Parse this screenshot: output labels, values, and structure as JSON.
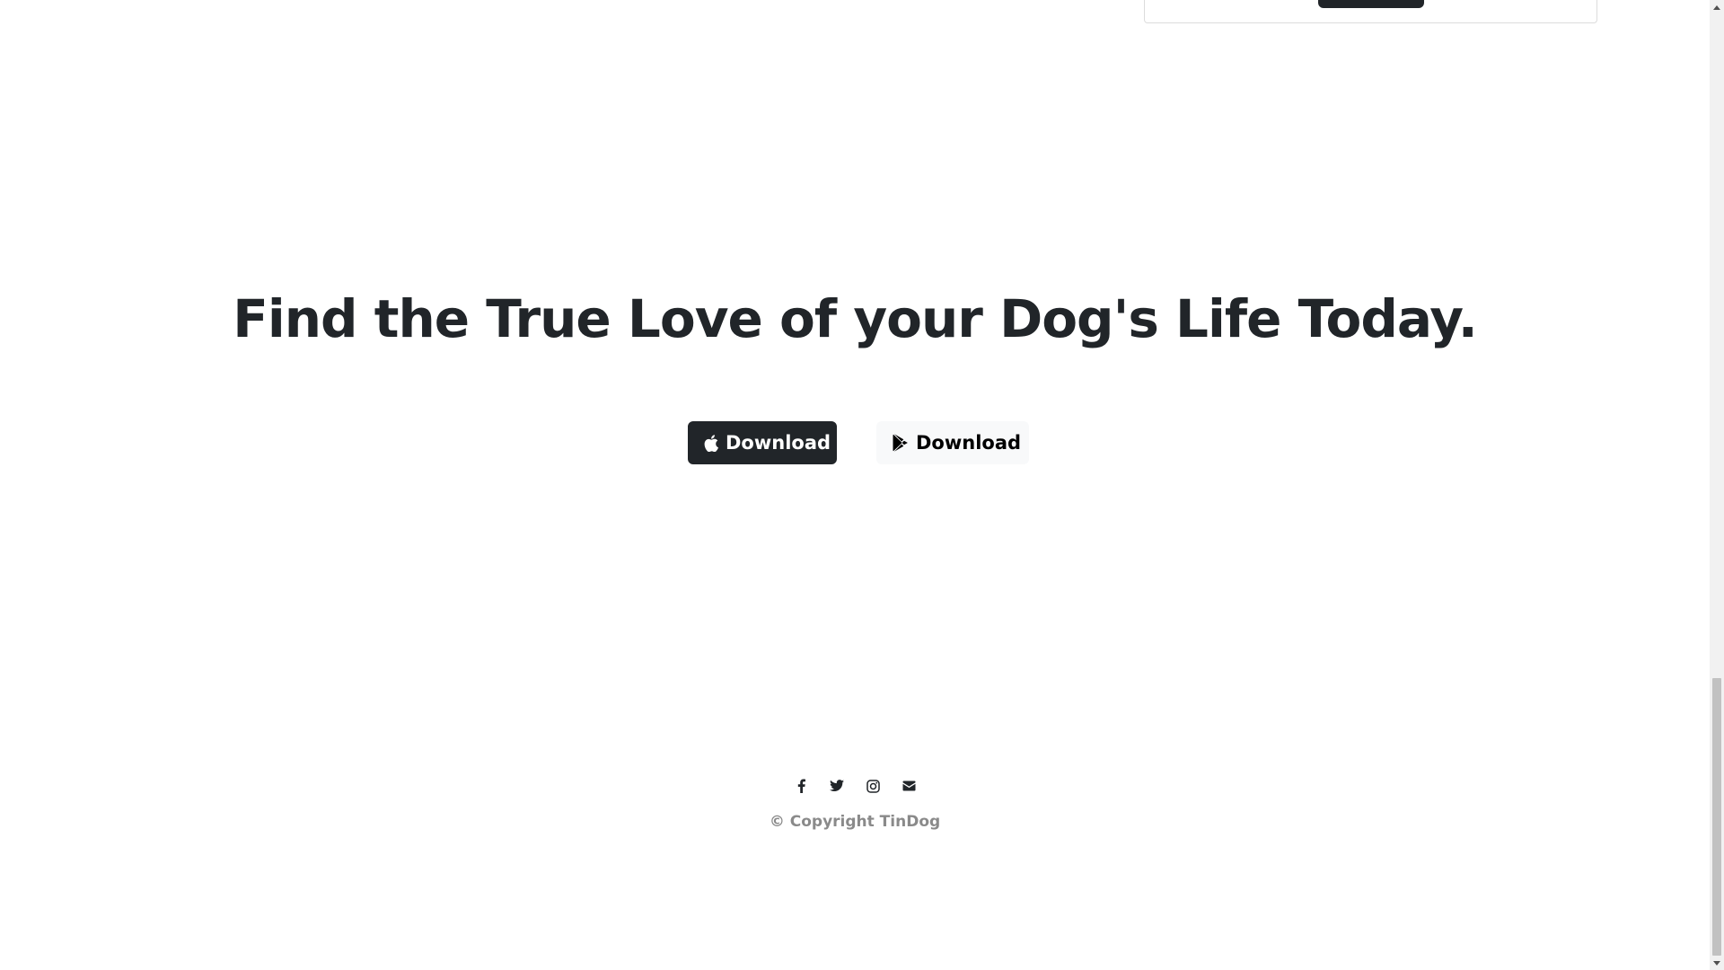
{
  "cta": {
    "title": "Find the True Love of your Dog's Life Today.",
    "apple_button_label": "Download",
    "google_button_label": "Download"
  },
  "footer": {
    "social_icons": [
      "facebook-icon",
      "twitter-icon",
      "instagram-icon",
      "envelope-icon"
    ],
    "copyright": "© Copyright TinDog"
  },
  "colors": {
    "dark": "#212529",
    "light_button": "#f8f9fa",
    "copyright_text": "#8a8a8a",
    "background": "#ffffff"
  }
}
